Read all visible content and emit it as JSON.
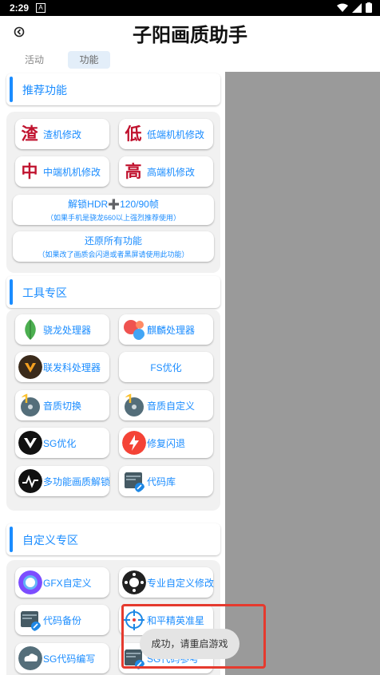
{
  "status": {
    "time": "2:29",
    "notif": "A"
  },
  "app_title": "子阳画质助手",
  "tabs": [
    {
      "label": "活动"
    },
    {
      "label": "功能"
    }
  ],
  "sections": {
    "recommend": "推荐功能",
    "tools": "工具专区",
    "custom": "自定义专区"
  },
  "recommend": {
    "b1": {
      "glyph": "渣",
      "label": "渣机修改"
    },
    "b2": {
      "glyph": "低",
      "label": "低端机机修改"
    },
    "b3": {
      "glyph": "中",
      "label": "中端机机修改"
    },
    "b4": {
      "glyph": "高",
      "label": "高端机修改"
    },
    "hdr": {
      "line1": "解锁HDR➕120/90帧",
      "line2": "（如果手机是骁龙660以上强烈推荐使用）"
    },
    "restore": {
      "line1": "还原所有功能",
      "line2": "（如果改了画质会闪退或者黑屏请使用此功能）"
    }
  },
  "tools": {
    "t1": "骁龙处理器",
    "t2": "麒麟处理器",
    "t3": "联发科处理器",
    "t4": "FS优化",
    "t5": "音质切换",
    "t6": "音质自定义",
    "t7": "SG优化",
    "t8": "修复闪退",
    "t9": "多功能画质解锁",
    "t10": "代码库"
  },
  "custom": {
    "c1": "GFX自定义",
    "c2": "专业自定义修改",
    "c3": "代码备份",
    "c4": "和平精英准星",
    "c5": "SG代码编写",
    "c6": "SG代码参考"
  },
  "toast": "成功，请重启游戏",
  "colors": {
    "accent": "#1a8cff",
    "glyph": "#c0122e",
    "highlight": "#e53a2e"
  }
}
